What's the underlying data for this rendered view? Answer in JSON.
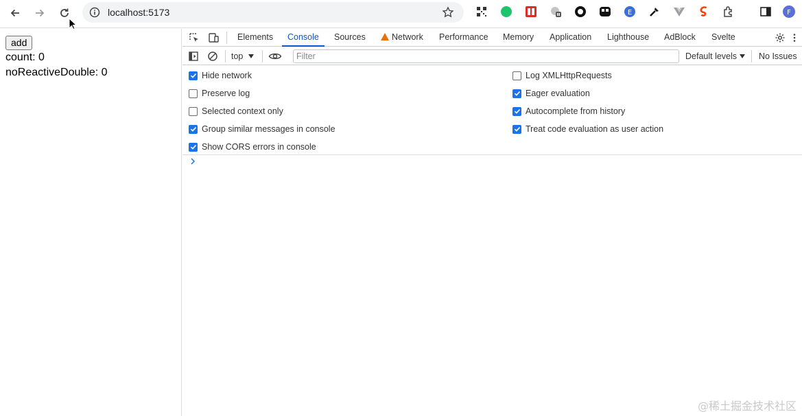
{
  "browser": {
    "url": "localhost:5173"
  },
  "page": {
    "add_label": "add",
    "count_text": "count: 0",
    "double_text": "noReactiveDouble: 0"
  },
  "devtools": {
    "tabs": [
      {
        "label": "Elements"
      },
      {
        "label": "Console"
      },
      {
        "label": "Sources"
      },
      {
        "label": "Network"
      },
      {
        "label": "Performance"
      },
      {
        "label": "Memory"
      },
      {
        "label": "Application"
      },
      {
        "label": "Lighthouse"
      },
      {
        "label": "AdBlock"
      },
      {
        "label": "Svelte"
      }
    ],
    "active_tab": "Console",
    "toolbar": {
      "context": "top",
      "filter_placeholder": "Filter",
      "levels": "Default levels",
      "issues": "No Issues"
    },
    "settings": [
      {
        "label": "Hide network",
        "checked": true
      },
      {
        "label": "Preserve log",
        "checked": false
      },
      {
        "label": "Selected context only",
        "checked": false
      },
      {
        "label": "Group similar messages in console",
        "checked": true
      },
      {
        "label": "Show CORS errors in console",
        "checked": true
      },
      {
        "label": "Log XMLHttpRequests",
        "checked": false
      },
      {
        "label": "Eager evaluation",
        "checked": true
      },
      {
        "label": "Autocomplete from history",
        "checked": true
      },
      {
        "label": "Treat code evaluation as user action",
        "checked": true
      }
    ]
  },
  "watermark": "@稀土掘金技术社区",
  "colors": {
    "accent": "#0b57d0",
    "checkbox": "#1a73e8",
    "warning": "#e8710a"
  }
}
